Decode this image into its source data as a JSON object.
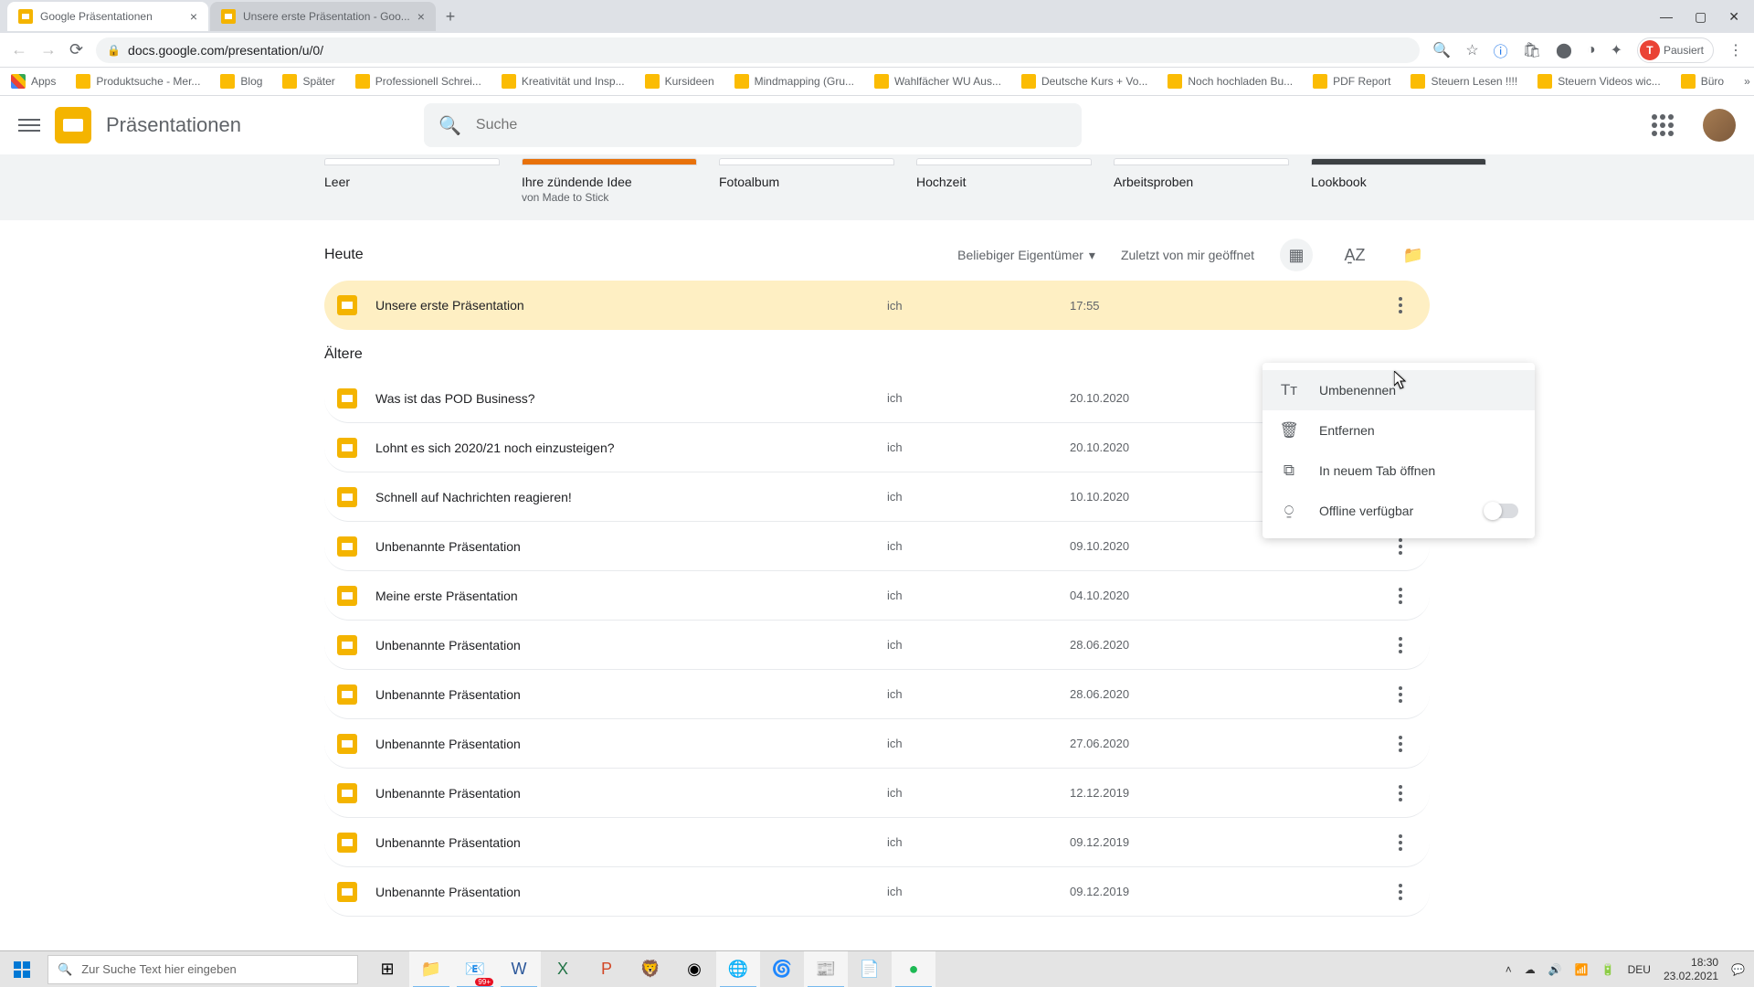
{
  "browser": {
    "tabs": [
      {
        "title": "Google Präsentationen",
        "active": true
      },
      {
        "title": "Unsere erste Präsentation - Goo...",
        "active": false
      }
    ],
    "url": "docs.google.com/presentation/u/0/",
    "profile_badge": "Pausiert",
    "profile_initial": "T",
    "bookmarks": {
      "apps": "Apps",
      "items": [
        "Produktsuche - Mer...",
        "Blog",
        "Später",
        "Professionell Schrei...",
        "Kreativität und Insp...",
        "Kursideen",
        "Mindmapping  (Gru...",
        "Wahlfächer WU Aus...",
        "Deutsche Kurs + Vo...",
        "Noch hochladen Bu...",
        "PDF Report",
        "Steuern Lesen !!!!",
        "Steuern Videos wic...",
        "Büro"
      ]
    }
  },
  "app": {
    "title": "Präsentationen",
    "search_placeholder": "Suche"
  },
  "templates": [
    {
      "label": "Leer",
      "sub": "",
      "color": "white"
    },
    {
      "label": "Ihre zündende Idee",
      "sub": "von Made to Stick",
      "color": "orange"
    },
    {
      "label": "Fotoalbum",
      "sub": "",
      "color": "white"
    },
    {
      "label": "Hochzeit",
      "sub": "",
      "color": "white"
    },
    {
      "label": "Arbeitsproben",
      "sub": "",
      "color": "white"
    },
    {
      "label": "Lookbook",
      "sub": "",
      "color": "dark"
    }
  ],
  "toolbar": {
    "section_today": "Heute",
    "section_older": "Ältere",
    "owner_filter": "Beliebiger Eigentümer",
    "sort_label": "Zuletzt von mir geöffnet"
  },
  "files": {
    "today": [
      {
        "name": "Unsere erste Präsentation",
        "owner": "ich",
        "date": "17:55"
      }
    ],
    "older": [
      {
        "name": "Was ist das POD Business?",
        "owner": "ich",
        "date": "20.10.2020"
      },
      {
        "name": "Lohnt es sich 2020/21 noch einzusteigen?",
        "owner": "ich",
        "date": "20.10.2020"
      },
      {
        "name": "Schnell auf Nachrichten reagieren!",
        "owner": "ich",
        "date": "10.10.2020"
      },
      {
        "name": "Unbenannte Präsentation",
        "owner": "ich",
        "date": "09.10.2020"
      },
      {
        "name": "Meine erste Präsentation",
        "owner": "ich",
        "date": "04.10.2020"
      },
      {
        "name": "Unbenannte Präsentation",
        "owner": "ich",
        "date": "28.06.2020"
      },
      {
        "name": "Unbenannte Präsentation",
        "owner": "ich",
        "date": "28.06.2020"
      },
      {
        "name": "Unbenannte Präsentation",
        "owner": "ich",
        "date": "27.06.2020"
      },
      {
        "name": "Unbenannte Präsentation",
        "owner": "ich",
        "date": "12.12.2019"
      },
      {
        "name": "Unbenannte Präsentation",
        "owner": "ich",
        "date": "09.12.2019"
      },
      {
        "name": "Unbenannte Präsentation",
        "owner": "ich",
        "date": "09.12.2019"
      }
    ]
  },
  "context_menu": {
    "rename": "Umbenennen",
    "remove": "Entfernen",
    "new_tab": "In neuem Tab öffnen",
    "offline": "Offline verfügbar"
  },
  "taskbar": {
    "search_placeholder": "Zur Suche Text hier eingeben",
    "lang": "DEU",
    "time": "18:30",
    "date": "23.02.2021",
    "badge": "99+"
  }
}
